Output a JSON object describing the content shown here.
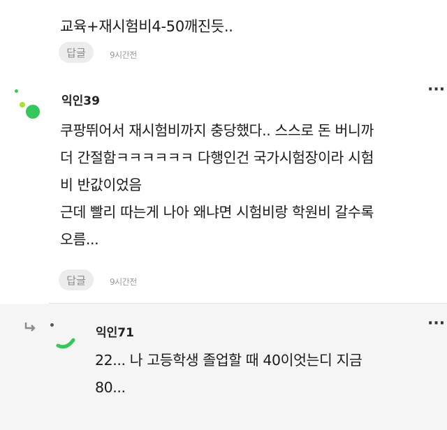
{
  "comment_prev": {
    "text": "교육+재시험비4-50깨진듯..",
    "reply_label": "답글",
    "time": "9시간전"
  },
  "comment_1": {
    "username": "익인39",
    "more_label": "···",
    "lines": [
      "쿠팡뛰어서 재시험비까지 충당했다.. 스스로 돈 버니까",
      "더 간절함ㅋㅋㅋㅋㅋㅋ 다행인건 국가시험장이라 시험",
      "비 반값이었음",
      "근데 빨리 따는게 나아 왜냐면 시험비랑 학원비 갈수록",
      "오름..."
    ],
    "reply_label": "답글",
    "time": "9시간전",
    "avatar_colors": {
      "main": "#34c759",
      "small": "#a6e22e"
    }
  },
  "reply_1": {
    "username": "익인71",
    "more_label": "···",
    "lines": [
      "22... 나 고등학생 졸업할 때 40이엇는디 지금",
      "80..."
    ],
    "avatar_color": "#34c759"
  }
}
